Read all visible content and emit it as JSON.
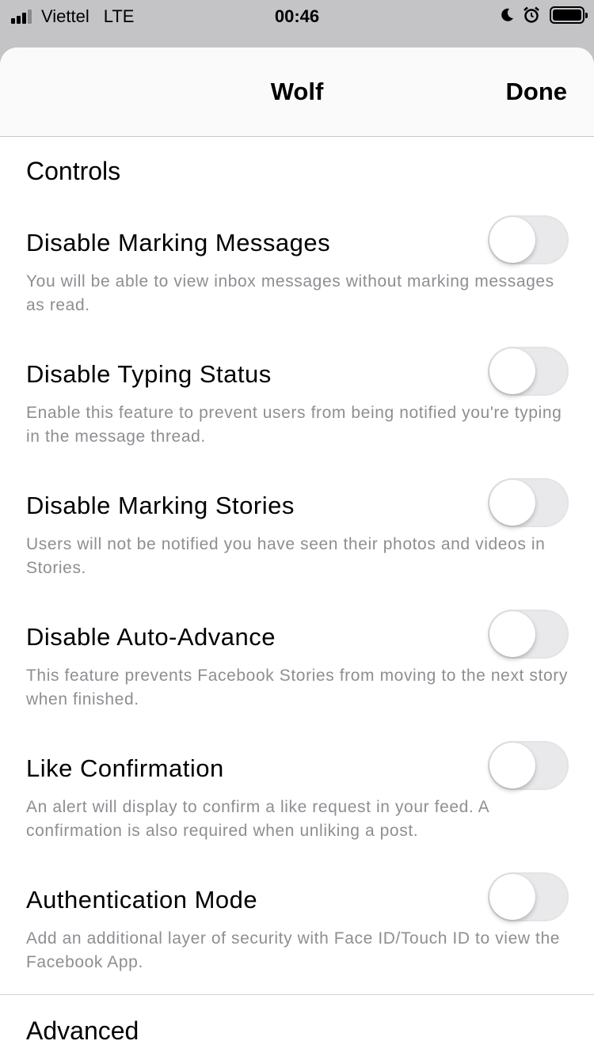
{
  "status_bar": {
    "carrier": "Viettel",
    "network": "LTE",
    "time": "00:46",
    "icons": [
      "signal-icon",
      "moon-icon",
      "alarm-icon",
      "battery-icon"
    ]
  },
  "nav": {
    "title": "Wolf",
    "done_label": "Done"
  },
  "sections": {
    "controls": "Controls",
    "advanced": "Advanced"
  },
  "settings": [
    {
      "title": "Disable Marking Messages",
      "description": "You will be able to view inbox messages without marking messages as read.",
      "enabled": false
    },
    {
      "title": "Disable Typing Status",
      "description": "Enable this feature to prevent users from being notified you're typing in the message thread.",
      "enabled": false
    },
    {
      "title": "Disable Marking Stories",
      "description": "Users will not be notified you have seen their photos and videos in Stories.",
      "enabled": false
    },
    {
      "title": "Disable Auto-Advance",
      "description": "This feature prevents Facebook Stories from moving to the next story when finished.",
      "enabled": false
    },
    {
      "title": "Like Confirmation",
      "description": "An alert will display to confirm a like request in your feed. A confirmation is also required when unliking a post.",
      "enabled": false
    },
    {
      "title": "Authentication Mode",
      "description": "Add an additional layer of security with Face ID/Touch ID to view the Facebook App.",
      "enabled": false
    }
  ],
  "colors": {
    "toggle_off": "#e9e9eb",
    "description_text": "#8e8e93",
    "background_dim": "#c4c4c6"
  }
}
